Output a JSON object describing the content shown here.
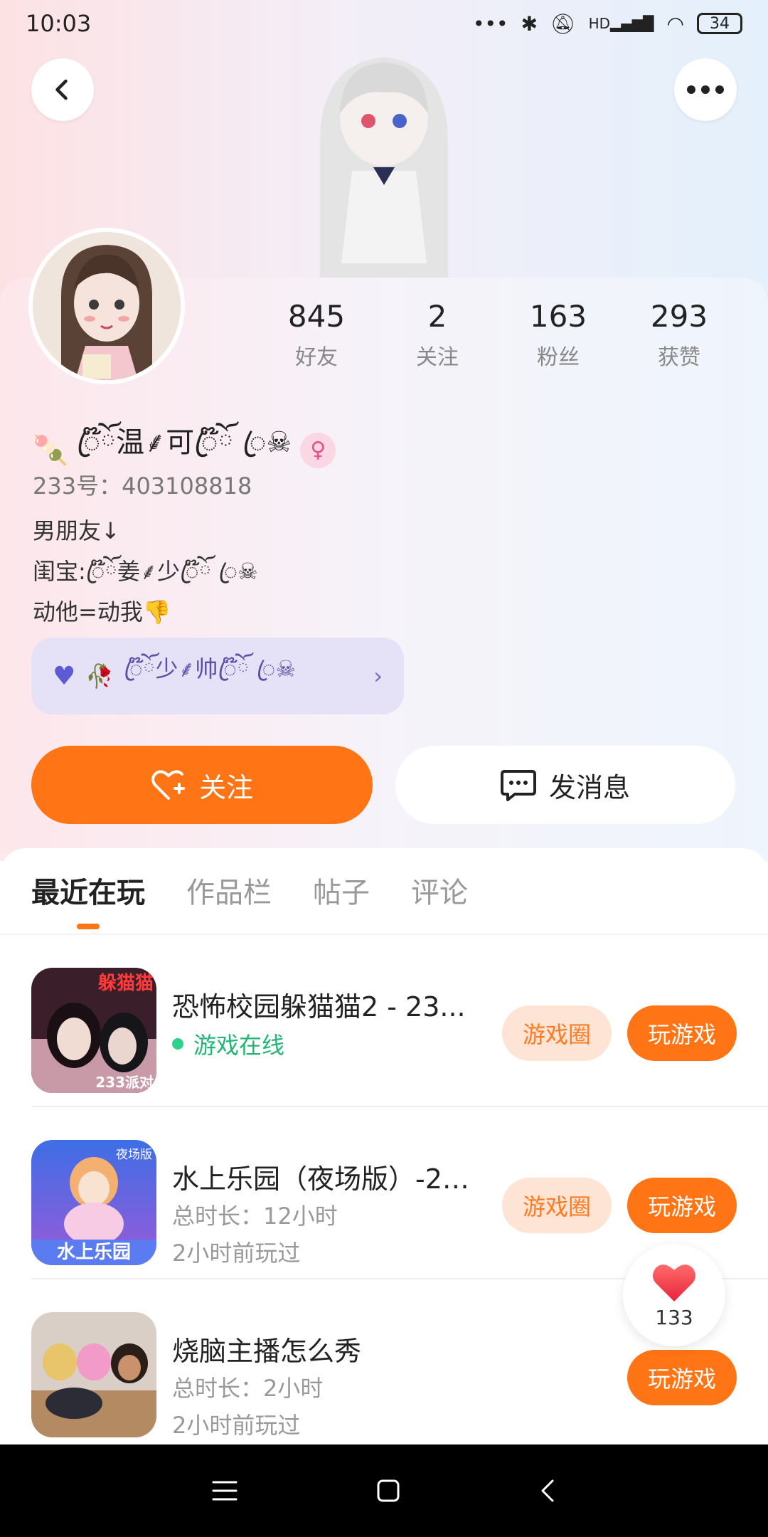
{
  "status_bar": {
    "time": "10:03",
    "signal_text": "HD",
    "battery": "34",
    "icons": [
      "dots-icon",
      "bluetooth-icon",
      "mute-bell-icon",
      "signal-icon",
      "wifi-icon",
      "battery-icon"
    ]
  },
  "header": {
    "back_icon": "chevron-left-icon",
    "more_icon": "more-dots-icon"
  },
  "profile": {
    "stats": [
      {
        "value": "845",
        "label": "好友"
      },
      {
        "value": "2",
        "label": "关注"
      },
      {
        "value": "163",
        "label": "粉丝"
      },
      {
        "value": "293",
        "label": "获赞"
      }
    ],
    "nickname": "ꦿ໊ོ温⸙可ꦿ໊ོ ꦿ☠",
    "uid": "233号：403108818",
    "bio_lines": [
      "男朋友↓",
      "闺宝:ꦿ໊ོ姜⸙少ꦿ໊ོ ꦿ☠",
      "动他=动我👎"
    ],
    "couple": {
      "text": "ꦿ໊ོ少⸙帅ꦿ໊ོ ꦿ☠"
    },
    "follow_label": "关注",
    "message_label": "发消息"
  },
  "tabs": [
    {
      "label": "最近在玩",
      "active": true
    },
    {
      "label": "作品栏",
      "active": false
    },
    {
      "label": "帖子",
      "active": false
    },
    {
      "label": "评论",
      "active": false
    }
  ],
  "games": [
    {
      "title": "恐怖校园躲猫猫2 - 23...",
      "status": "游戏在线",
      "circle_label": "游戏圈",
      "play_label": "玩游戏",
      "icon_text": "躲猫猫",
      "icon_badge": "233派对"
    },
    {
      "title": "水上乐园（夜场版）-23...",
      "duration": "总时长：12小时",
      "last_played": "2小时前玩过",
      "circle_label": "游戏圈",
      "play_label": "玩游戏",
      "icon_text": "水上乐园",
      "icon_badge": "夜场版"
    },
    {
      "title": "烧脑主播怎么秀",
      "duration": "总时长：2小时",
      "last_played": "2小时前玩过",
      "play_label": "玩游戏"
    }
  ],
  "like_float": {
    "count": "133"
  },
  "colors": {
    "accent": "#ff7414",
    "accent_light": "#fde4d4",
    "online_green": "#22b573",
    "couple_pill": "#e5e1f6"
  }
}
